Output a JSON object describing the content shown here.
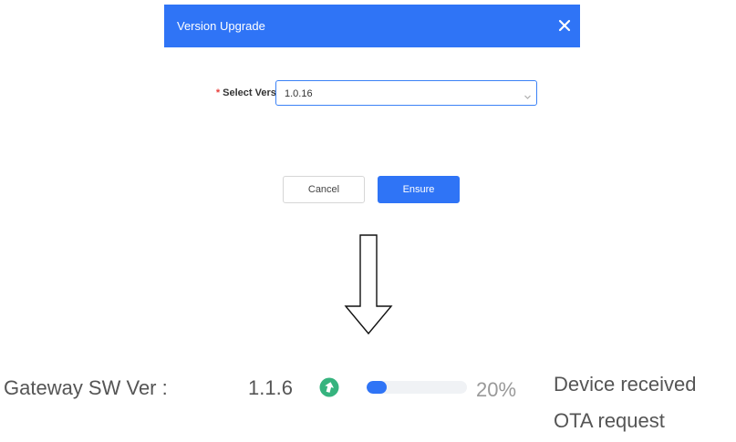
{
  "dialog": {
    "title": "Version Upgrade",
    "close_icon": "close-icon",
    "field_label": "Select Version:",
    "required_mark": "*",
    "selected_version": "1.0.16",
    "chevron_icon": "chevron-down-icon",
    "cancel_label": "Cancel",
    "ensure_label": "Ensure"
  },
  "status": {
    "label": "Gateway SW Ver :",
    "version": "1.1.6",
    "upgrade_icon": "upgrade-arrow-icon",
    "progress_percent": 20,
    "progress_text": "20%",
    "message": "Device received OTA request"
  },
  "colors": {
    "header_blue": "#2f74f6",
    "upgrade_green": "#36b37e",
    "required_red": "#e8413c"
  }
}
